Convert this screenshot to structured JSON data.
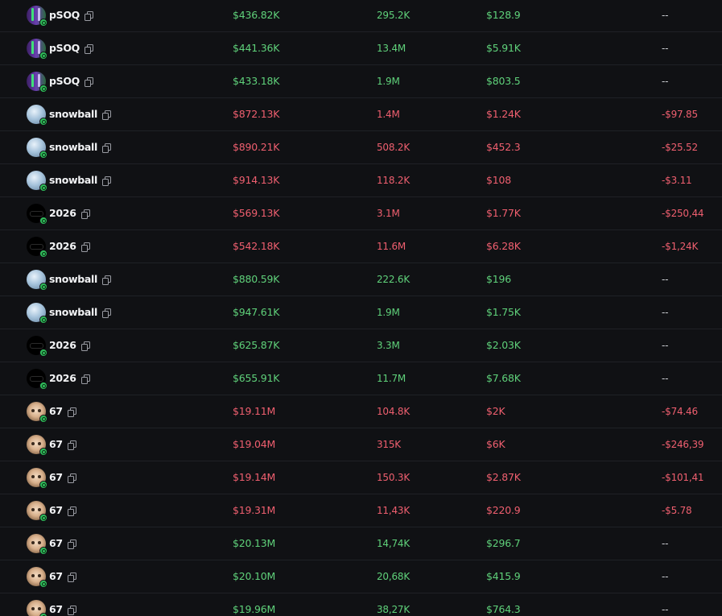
{
  "colors": {
    "background": "#101114",
    "buy": "#5fd17a",
    "sell": "#ef5f6f",
    "row_divider": "#1f2126"
  },
  "trades": [
    {
      "token": "pSOQ",
      "avatar": "psoq-token-icon",
      "side": "buy",
      "mcap": "$436.82K",
      "amount": "295.2K",
      "value": "$128.9",
      "pnl": "--"
    },
    {
      "token": "pSOQ",
      "avatar": "psoq-token-icon",
      "side": "buy",
      "mcap": "$441.36K",
      "amount": "13.4M",
      "value": "$5.91K",
      "pnl": "--"
    },
    {
      "token": "pSOQ",
      "avatar": "psoq-token-icon",
      "side": "buy",
      "mcap": "$433.18K",
      "amount": "1.9M",
      "value": "$803.5",
      "pnl": "--"
    },
    {
      "token": "snowball",
      "avatar": "snowball-token-icon",
      "side": "sell",
      "mcap": "$872.13K",
      "amount": "1.4M",
      "value": "$1.24K",
      "pnl": "-$97.85"
    },
    {
      "token": "snowball",
      "avatar": "snowball-token-icon",
      "side": "sell",
      "mcap": "$890.21K",
      "amount": "508.2K",
      "value": "$452.3",
      "pnl": "-$25.52"
    },
    {
      "token": "snowball",
      "avatar": "snowball-token-icon",
      "side": "sell",
      "mcap": "$914.13K",
      "amount": "118.2K",
      "value": "$108",
      "pnl": "-$3.11"
    },
    {
      "token": "2026",
      "avatar": "2026-token-icon",
      "side": "sell",
      "mcap": "$569.13K",
      "amount": "3.1M",
      "value": "$1.77K",
      "pnl": "-$250,44"
    },
    {
      "token": "2026",
      "avatar": "2026-token-icon",
      "side": "sell",
      "mcap": "$542.18K",
      "amount": "11.6M",
      "value": "$6.28K",
      "pnl": "-$1,24K"
    },
    {
      "token": "snowball",
      "avatar": "snowball-token-icon",
      "side": "buy",
      "mcap": "$880.59K",
      "amount": "222.6K",
      "value": "$196",
      "pnl": "--"
    },
    {
      "token": "snowball",
      "avatar": "snowball-token-icon",
      "side": "buy",
      "mcap": "$947.61K",
      "amount": "1.9M",
      "value": "$1.75K",
      "pnl": "--"
    },
    {
      "token": "2026",
      "avatar": "2026-token-icon",
      "side": "buy",
      "mcap": "$625.87K",
      "amount": "3.3M",
      "value": "$2.03K",
      "pnl": "--"
    },
    {
      "token": "2026",
      "avatar": "2026-token-icon",
      "side": "buy",
      "mcap": "$655.91K",
      "amount": "11.7M",
      "value": "$7.68K",
      "pnl": "--"
    },
    {
      "token": "67",
      "avatar": "67-token-icon",
      "side": "sell",
      "mcap": "$19.11M",
      "amount": "104.8K",
      "value": "$2K",
      "pnl": "-$74.46"
    },
    {
      "token": "67",
      "avatar": "67-token-icon",
      "side": "sell",
      "mcap": "$19.04M",
      "amount": "315K",
      "value": "$6K",
      "pnl": "-$246,39"
    },
    {
      "token": "67",
      "avatar": "67-token-icon",
      "side": "sell",
      "mcap": "$19.14M",
      "amount": "150.3K",
      "value": "$2.87K",
      "pnl": "-$101,41"
    },
    {
      "token": "67",
      "avatar": "67-token-icon",
      "side": "sell",
      "mcap": "$19.31M",
      "amount": "11,43K",
      "value": "$220.9",
      "pnl": "-$5.78"
    },
    {
      "token": "67",
      "avatar": "67-token-icon",
      "side": "buy",
      "mcap": "$20.13M",
      "amount": "14,74K",
      "value": "$296.7",
      "pnl": "--"
    },
    {
      "token": "67",
      "avatar": "67-token-icon",
      "side": "buy",
      "mcap": "$20.10M",
      "amount": "20,68K",
      "value": "$415.9",
      "pnl": "--"
    },
    {
      "token": "67",
      "avatar": "67-token-icon",
      "side": "buy",
      "mcap": "$19.96M",
      "amount": "38,27K",
      "value": "$764.3",
      "pnl": "--"
    }
  ]
}
